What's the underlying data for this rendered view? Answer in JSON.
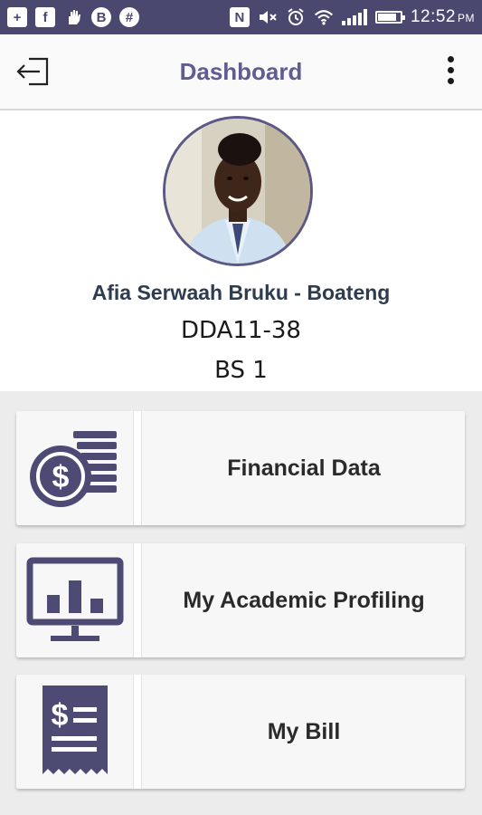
{
  "status_bar": {
    "time": "12:52",
    "ampm": "PM",
    "battery_level": 0.85
  },
  "header": {
    "title": "Dashboard"
  },
  "profile": {
    "name": "Afia Serwaah Bruku - Boateng",
    "student_id": "DDA11-38",
    "class": "BS 1"
  },
  "menu": {
    "items": [
      {
        "label": "Financial Data",
        "icon": "coins-dollar-icon"
      },
      {
        "label": "My Academic Profiling",
        "icon": "monitor-chart-icon"
      },
      {
        "label": "My Bill",
        "icon": "receipt-icon"
      }
    ]
  },
  "colors": {
    "primary": "#4b4870",
    "title": "#5f5c92",
    "icon": "#4d4a74"
  }
}
